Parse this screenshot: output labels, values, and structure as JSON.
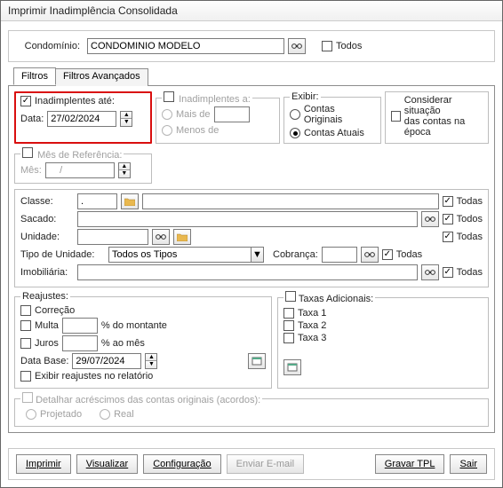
{
  "window_title": "Imprimir Inadimplência Consolidada",
  "top": {
    "condo_label": "Condomínio:",
    "condo_value": "CONDOMINIO MODELO",
    "todos_label": "Todos"
  },
  "tabs": {
    "filtros": "Filtros",
    "avancados": "Filtros Avançados"
  },
  "inadimplentes_ate": {
    "title": "Inadimplentes até:",
    "data_label": "Data:",
    "data_value": "27/02/2024"
  },
  "inadimplentes_a": {
    "title": "Inadimplentes a:",
    "mais_label": "Mais de",
    "menos_label": "Menos de"
  },
  "exibir": {
    "title": "Exibir:",
    "originais": "Contas Originais",
    "atuais": "Contas Atuais"
  },
  "considerar": {
    "line1": "Considerar situação",
    "line2": "das contas na época"
  },
  "mes_ref": {
    "title": "Mês de Referência:",
    "mes_label": "Mês:",
    "mes_value": "    /"
  },
  "filters": {
    "classe_label": "Classe:",
    "classe_value": ".",
    "sacado_label": "Sacado:",
    "unidade_label": "Unidade:",
    "tipo_unidade_label": "Tipo de Unidade:",
    "tipo_unidade_value": "Todos os Tipos",
    "cobranca_label": "Cobrança:",
    "imobiliaria_label": "Imobiliária:",
    "todas": "Todas",
    "todos": "Todos"
  },
  "reajustes": {
    "title": "Reajustes:",
    "correcao": "Correção",
    "multa": "Multa",
    "multa_suffix": "% do montante",
    "juros": "Juros",
    "juros_suffix": "% ao mês",
    "data_base_label": "Data Base:",
    "data_base_value": "29/07/2024",
    "exibir_rel": "Exibir reajustes no relatório"
  },
  "taxas": {
    "title": "Taxas Adicionais:",
    "t1": "Taxa 1",
    "t2": "Taxa 2",
    "t3": "Taxa 3"
  },
  "detalhar": {
    "title": "Detalhar acréscimos das contas originais (acordos):",
    "projetado": "Projetado",
    "real": "Real"
  },
  "buttons": {
    "imprimir": "Imprimir",
    "visualizar": "Visualizar",
    "configuracao": "Configuração",
    "enviar_email": "Enviar E-mail",
    "gravar_tpl": "Gravar TPL",
    "sair": "Sair"
  },
  "icons": {
    "up": "▲",
    "down": "▼",
    "ddown": "▼"
  }
}
